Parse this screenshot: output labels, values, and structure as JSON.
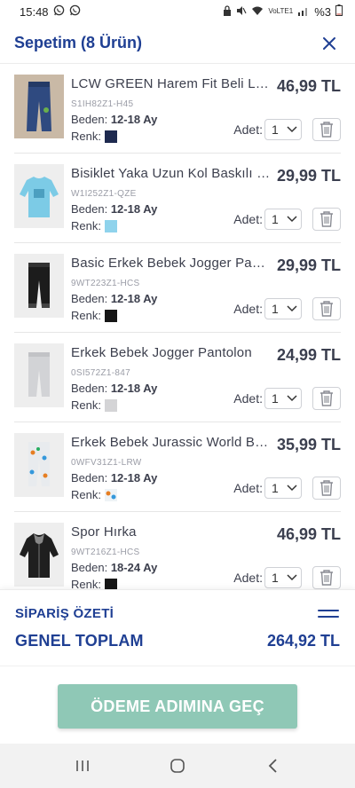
{
  "status_bar": {
    "time": "15:48",
    "battery": "%3",
    "network_small": "VoLTE1",
    "network_lte": "LTE1"
  },
  "header": {
    "title": "Sepetim (8 Ürün)"
  },
  "labels": {
    "size": "Beden:",
    "color": "Renk:",
    "qty": "Adet:"
  },
  "items": [
    {
      "name": "LCW GREEN Harem Fit Beli Lastikli Pantolon",
      "price": "46,99 TL",
      "sku": "S1IH82Z1-H45",
      "size": "12-18 Ay",
      "color_hex": "#1e2a4f",
      "qty": "1",
      "image": "jeans-image"
    },
    {
      "name": "Bisiklet Yaka Uzun Kol Baskılı Penye",
      "price": "29,99 TL",
      "sku": "W1I252Z1-QZE",
      "size": "12-18 Ay",
      "color_hex": "#8fd3ec",
      "qty": "1",
      "image": "sweatshirt-image"
    },
    {
      "name": "Basic Erkek Bebek Jogger Pantolon",
      "price": "29,99 TL",
      "sku": "9WT223Z1-HCS",
      "size": "12-18 Ay",
      "color_hex": "#161616",
      "qty": "1",
      "image": "black-jogger-image"
    },
    {
      "name": "Erkek Bebek Jogger Pantolon",
      "price": "24,99 TL",
      "sku": "0SI572Z1-847",
      "size": "12-18 Ay",
      "color_hex": "#d4d4d6",
      "qty": "1",
      "image": "grey-jogger-image"
    },
    {
      "name": "Erkek Bebek Jurassic World Baskılı Pantolon",
      "price": "35,99 TL",
      "sku": "0WFV31Z1-LRW",
      "size": "12-18 Ay",
      "color_hex": "pattern",
      "qty": "1",
      "image": "printed-pants-image"
    },
    {
      "name": "Spor Hırka",
      "price": "46,99 TL",
      "sku": "9WT216Z1-HCS",
      "size": "18-24 Ay",
      "color_hex": "#161616",
      "qty": "1",
      "image": "cardigan-image"
    }
  ],
  "summary": {
    "title": "SİPARİŞ ÖZETİ",
    "total_label": "GENEL TOPLAM",
    "total_value": "264,92 TL"
  },
  "checkout": {
    "label": "ÖDEME ADIMINA GEÇ"
  }
}
